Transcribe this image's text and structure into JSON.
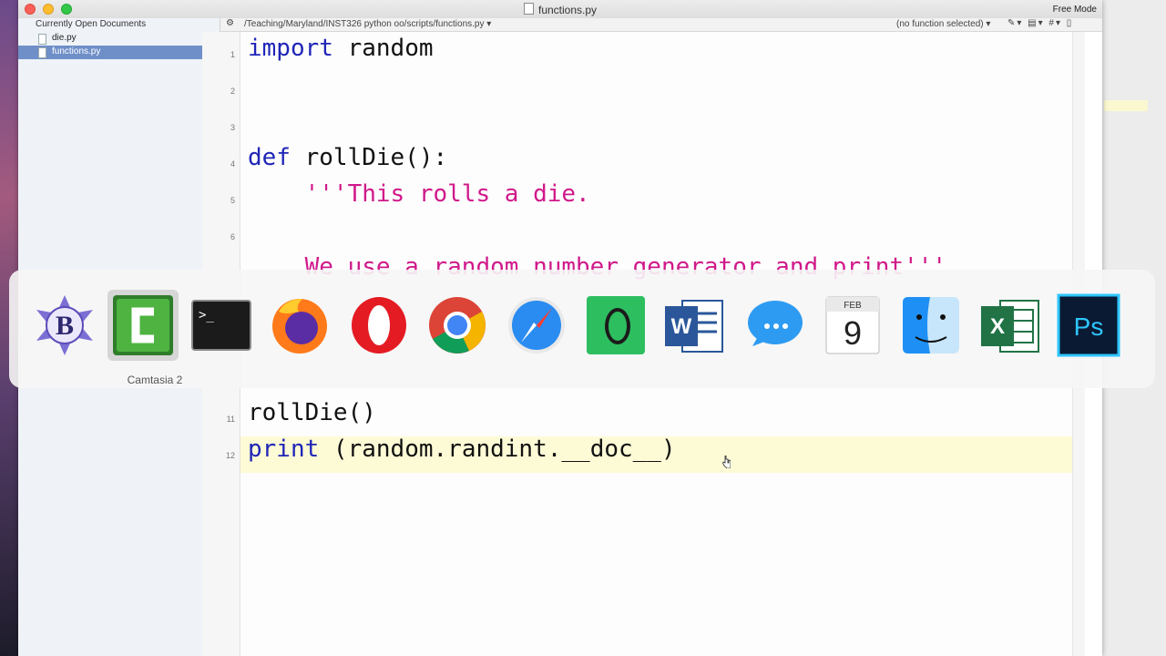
{
  "window": {
    "title": "functions.py",
    "mode": "Free Mode"
  },
  "sidebar": {
    "header": "Currently Open Documents",
    "docs": [
      {
        "name": "die.py"
      },
      {
        "name": "functions.py"
      }
    ]
  },
  "navbar": {
    "path": "/Teaching/Maryland/INST326 python oo/scripts/functions.py",
    "function_menu": "(no function selected)"
  },
  "editor": {
    "lines": [
      {
        "no": "1",
        "kw": "import",
        "rest": " random"
      },
      {
        "no": "2"
      },
      {
        "no": "3"
      },
      {
        "no": "4",
        "kw": "def",
        "rest": " rollDie():"
      },
      {
        "no": "5",
        "str": "    '''This rolls a die."
      },
      {
        "no": "6"
      },
      {
        "str": "    We use a random number generator and print'''"
      },
      {
        "no": "11",
        "rest": "rollDie()"
      },
      {
        "no": "12",
        "kw": "print",
        "rest": " (random.randint.__doc__)"
      }
    ]
  },
  "app_switcher": {
    "selected_label": "Camtasia 2",
    "apps": [
      {
        "icon": "bbedit-icon"
      },
      {
        "icon": "camtasia-icon"
      },
      {
        "icon": "terminal-icon"
      },
      {
        "icon": "firefox-icon"
      },
      {
        "icon": "opera-icon"
      },
      {
        "icon": "chrome-icon"
      },
      {
        "icon": "safari-icon"
      },
      {
        "icon": "evernote-icon"
      },
      {
        "icon": "word-icon"
      },
      {
        "icon": "messages-icon"
      },
      {
        "icon": "calendar-icon",
        "month": "FEB",
        "day": "9"
      },
      {
        "icon": "finder-icon"
      },
      {
        "icon": "excel-icon"
      },
      {
        "icon": "photoshop-icon"
      }
    ]
  }
}
